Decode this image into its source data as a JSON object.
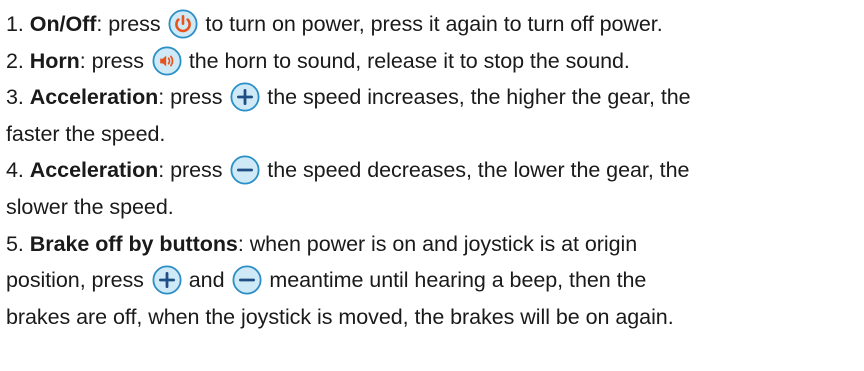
{
  "items": [
    {
      "num": "1.",
      "title": "On/Off",
      "colon": ":",
      "before_icon": " press",
      "after_icon": "to turn on power, press it again to turn off power."
    },
    {
      "num": "2.",
      "title": "Horn",
      "colon": ":",
      "before_icon": " press",
      "after_icon": "the horn to sound, release it to stop the sound."
    },
    {
      "num": "3.",
      "title": "Acceleration",
      "colon": ":",
      "before_icon": " press",
      "after_icon": "the speed increases, the higher the gear, the",
      "line2": "faster the speed."
    },
    {
      "num": "4.",
      "title": "Acceleration",
      "colon": ":",
      "before_icon": " press",
      "after_icon": "the speed decreases, the lower the gear, the",
      "line2": "slower the speed."
    },
    {
      "num": "5.",
      "title": "Brake off by buttons",
      "colon": ":",
      "line1_rest": " when power is on and joystick is at origin",
      "line2_a": "position, press",
      "line2_b": "and",
      "line2_c": "meantime until hearing a beep, then the",
      "line3": "brakes are off, when the joystick is moved, the brakes will be on again."
    }
  ],
  "colors": {
    "icon_fill": "#cfe9f7",
    "icon_border": "#2a8fc7",
    "power_glyph": "#e8531c",
    "horn_glyph": "#e8531c",
    "plus_minus_glyph": "#1f4f86",
    "text": "#1a1a1a"
  },
  "icons": {
    "power": "power-icon",
    "horn": "horn-icon",
    "plus": "plus-icon",
    "minus": "minus-icon"
  }
}
